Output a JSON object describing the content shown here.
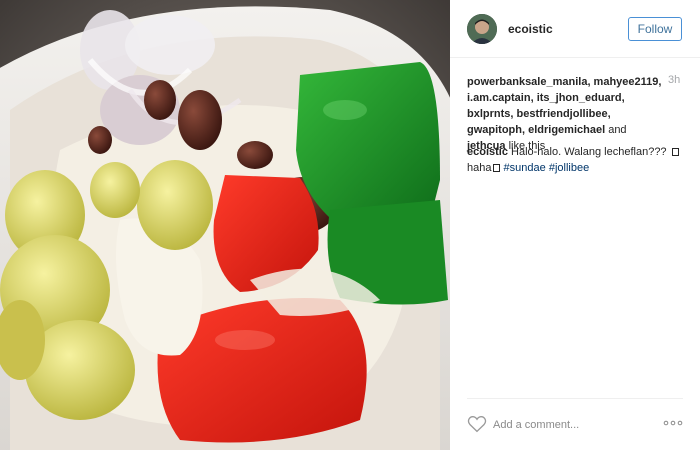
{
  "header": {
    "username": "ecoistic",
    "follow_label": "Follow"
  },
  "likes": {
    "names": "powerbanksale_manila, mahyee2119, i.am.captain, its_jhon_eduard, bxlprnts, bestfriendjollibee, gwapitoph, eldrigemichael",
    "and": " and ",
    "last": "jethcua",
    "suffix": " like this",
    "timestamp": "3h"
  },
  "caption": {
    "user": "ecoistic",
    "text1": " Halo-halo. Walang lecheflan??? ",
    "text2": "haha",
    "tag1": "#sundae",
    "tag2": "#jollibee"
  },
  "footer": {
    "comment_placeholder": "Add a comment..."
  },
  "icons": {
    "heart": "heart-icon",
    "more": "more-options-icon",
    "avatar": "avatar"
  },
  "colors": {
    "follow_border": "#4a90d6",
    "follow_text": "#3f729b",
    "hashtag": "#003569",
    "timestamp": "#a5a7aa"
  }
}
